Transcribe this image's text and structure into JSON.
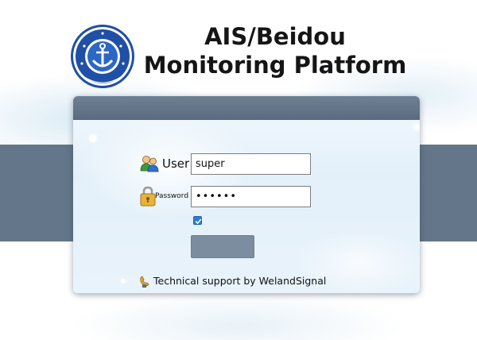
{
  "header": {
    "title_line1": "AIS/Beidou",
    "title_line2": "Monitoring Platform",
    "logo_icon": "china-msa-emblem-icon"
  },
  "login": {
    "user_label": "User",
    "user_value": "super",
    "password_label": "Password",
    "password_value": "••••••",
    "remember_checked": true,
    "login_button_label": ""
  },
  "footer": {
    "support_text": "Technical support by WelandSignal"
  },
  "colors": {
    "band": "#647689",
    "panel_header": "#647689",
    "button": "#7d8da0",
    "checkbox": "#2a7be0"
  }
}
